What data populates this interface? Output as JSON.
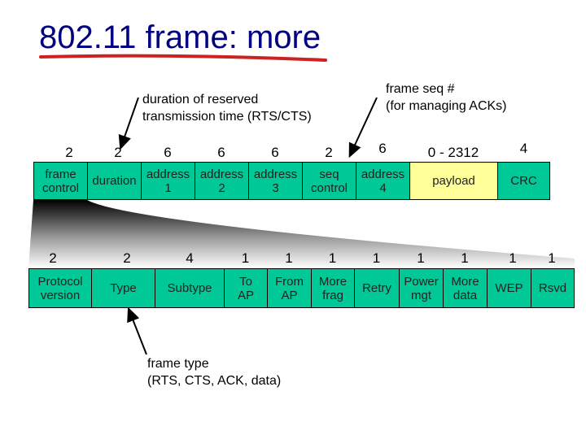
{
  "title": "802.11 frame: more",
  "colors": {
    "title": "#000080",
    "underline": "#cc2222",
    "field": "#00c896",
    "payload": "#ffff99"
  },
  "annotations": {
    "duration_note": [
      "duration of reserved",
      "transmission time (RTS/CTS)"
    ],
    "seq_note": [
      "frame seq #",
      "(for managing ACKs)"
    ],
    "type_note": [
      "frame type",
      "(RTS, CTS, ACK, data)"
    ]
  },
  "frame": {
    "fields": [
      {
        "size": "2",
        "label": [
          "frame",
          "control"
        ]
      },
      {
        "size": "2",
        "label": [
          "duration"
        ]
      },
      {
        "size": "6",
        "label": [
          "address",
          "1"
        ]
      },
      {
        "size": "6",
        "label": [
          "address",
          "2"
        ]
      },
      {
        "size": "6",
        "label": [
          "address",
          "3"
        ]
      },
      {
        "size": "2",
        "label": [
          "seq",
          "control"
        ]
      },
      {
        "size": "6",
        "label": [
          "address",
          "4"
        ]
      },
      {
        "size": "0 - 2312",
        "label": [
          "payload"
        ]
      },
      {
        "size": "4",
        "label": [
          "CRC"
        ]
      }
    ]
  },
  "frame_control": {
    "fields": [
      {
        "size": "2",
        "label": [
          "Protocol",
          "version"
        ]
      },
      {
        "size": "2",
        "label": [
          "Type"
        ]
      },
      {
        "size": "4",
        "label": [
          "Subtype"
        ]
      },
      {
        "size": "1",
        "label": [
          "To",
          "AP"
        ]
      },
      {
        "size": "1",
        "label": [
          "From",
          "AP"
        ]
      },
      {
        "size": "1",
        "label": [
          "More",
          "frag"
        ]
      },
      {
        "size": "1",
        "label": [
          "Retry"
        ]
      },
      {
        "size": "1",
        "label": [
          "Power",
          "mgt"
        ]
      },
      {
        "size": "1",
        "label": [
          "More",
          "data"
        ]
      },
      {
        "size": "1",
        "label": [
          "WEP"
        ]
      },
      {
        "size": "1",
        "label": [
          "Rsvd"
        ]
      }
    ]
  }
}
